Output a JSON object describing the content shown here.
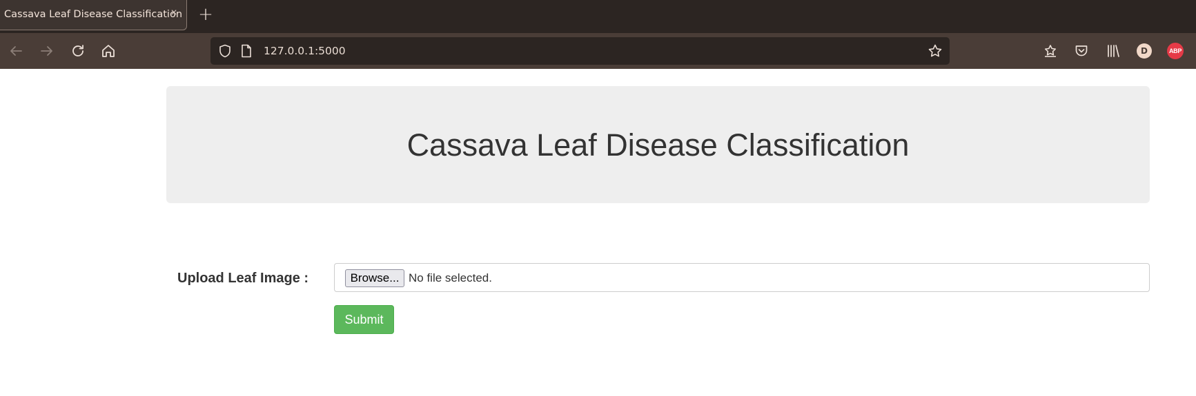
{
  "browser": {
    "tab": {
      "title": "Cassava Leaf Disease Classification",
      "close_glyph": "×"
    },
    "new_tab_glyph": "+",
    "url": "127.0.0.1:5000",
    "profile_initial": "D",
    "adblock_label": "ABP",
    "colors": {
      "tabbar": "#2c2522",
      "toolbar": "#4a3d37",
      "urlbar": "#2c2522"
    },
    "icons": [
      "back-icon",
      "forward-icon",
      "reload-icon",
      "home-icon",
      "shield-icon",
      "page-icon",
      "bookmark-star-icon",
      "pocket-save-icon",
      "pocket-icon",
      "library-icon",
      "profile-icon",
      "adblock-icon"
    ]
  },
  "page": {
    "title": "Cassava Leaf Disease Classification",
    "form": {
      "upload_label": "Upload Leaf Image :",
      "browse_label": "Browse...",
      "file_status": "No file selected.",
      "submit_label": "Submit"
    },
    "colors": {
      "jumbotron": "#eeeeee",
      "submit": "#5cb85c",
      "text": "#333333"
    }
  }
}
